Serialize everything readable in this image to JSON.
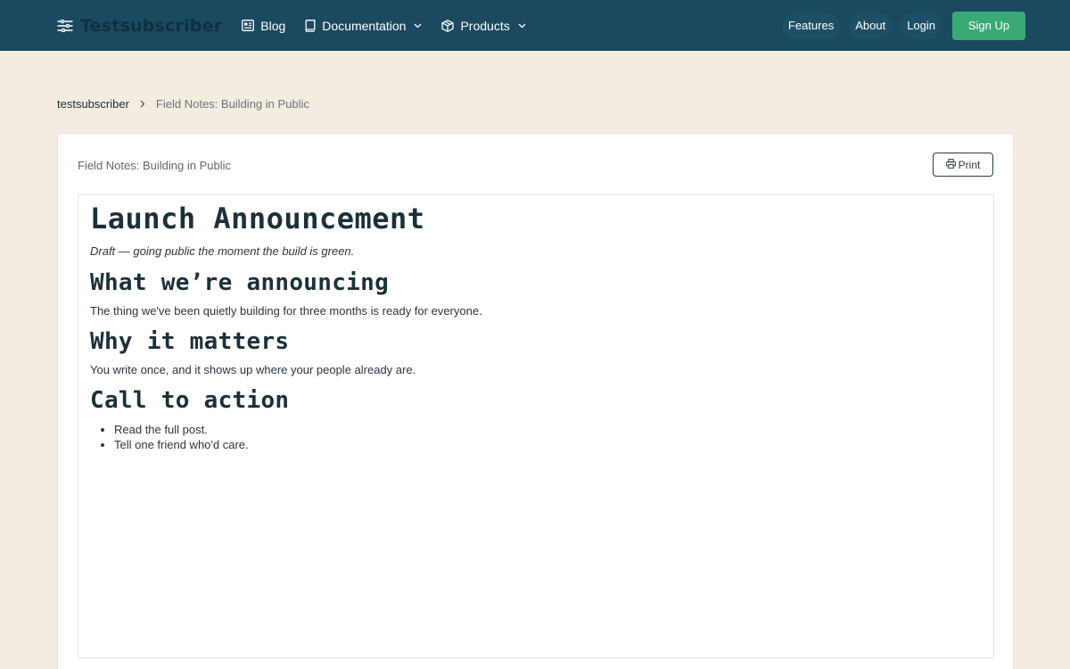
{
  "nav": {
    "brand": "Testsubscriber",
    "items": [
      {
        "label": "Blog",
        "icon": "newspaper-icon"
      },
      {
        "label": "Documentation",
        "icon": "book-icon"
      },
      {
        "label": "Products",
        "icon": "package-icon"
      }
    ],
    "right": [
      {
        "label": "Features"
      },
      {
        "label": "About"
      },
      {
        "label": "Login"
      }
    ],
    "signup": "Sign Up"
  },
  "breadcrumb": {
    "home": "testsubscriber",
    "current": "Field Notes: Building in Public"
  },
  "card": {
    "title": "Field Notes: Building in Public",
    "print": "Print"
  },
  "doc": {
    "title": "Launch Announcement",
    "lead": "Draft — going public the moment the build is green.",
    "sections": [
      {
        "heading": "What we’re announcing",
        "text": "The thing we've been quietly building for three months is ready for everyone."
      },
      {
        "heading": "Why it matters",
        "text": "You write once, and it shows up where your people already are."
      },
      {
        "heading": "Call to action",
        "items": [
          "Read the full post.",
          "Tell one friend who'd care."
        ]
      }
    ]
  },
  "colors": {
    "navbar": "#1b4a60",
    "background": "#f3ece1",
    "accent": "#3aa978"
  }
}
